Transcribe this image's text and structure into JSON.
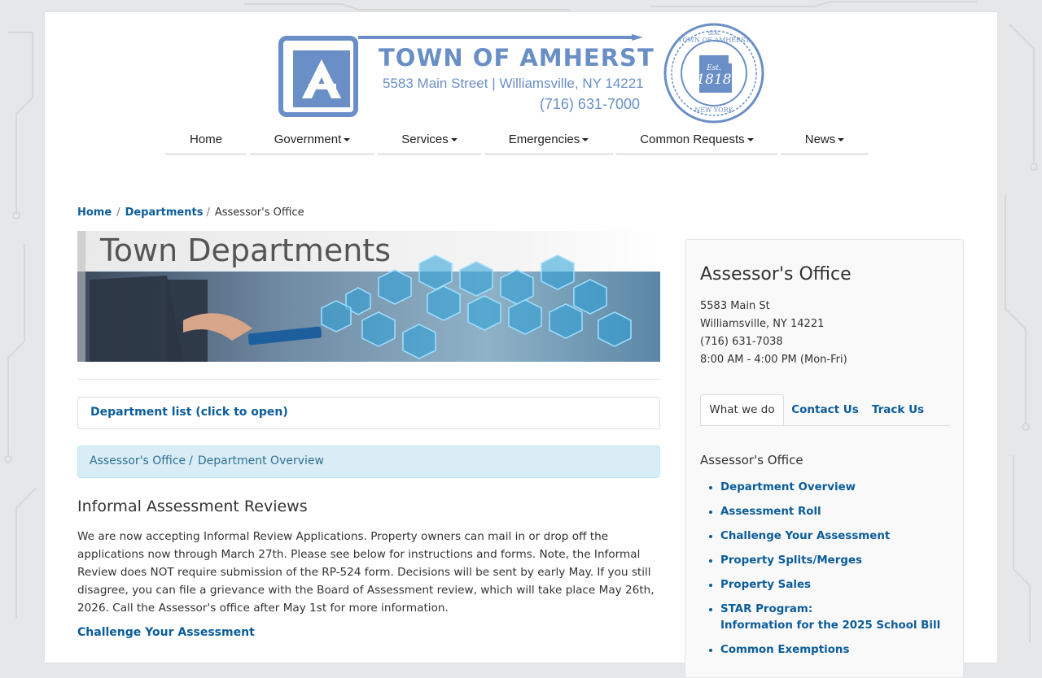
{
  "header": {
    "logo_title": "TOWN OF AMHERST",
    "logo_address": "5583 Main Street  |  Williamsville, NY 14221",
    "logo_phone": "(716) 631-7000",
    "seal_year": "1818",
    "seal_est": "Est.",
    "seal_top": "TOWN OF AMHERST",
    "seal_bottom": "NEW YORK",
    "seal_small": "SEAL"
  },
  "nav": {
    "items": [
      {
        "label": "Home",
        "dropdown": false
      },
      {
        "label": "Government",
        "dropdown": true
      },
      {
        "label": "Services",
        "dropdown": true
      },
      {
        "label": "Emergencies",
        "dropdown": true
      },
      {
        "label": "Common Requests",
        "dropdown": true
      },
      {
        "label": "News",
        "dropdown": true
      }
    ]
  },
  "breadcrumb": {
    "home": "Home",
    "departments": "Departments",
    "current": "Assessor's Office"
  },
  "banner": {
    "title": "Town Departments"
  },
  "department_list_label": "Department list (click to open)",
  "alert": {
    "office": "Assessor's Office",
    "page": "Department Overview"
  },
  "content": {
    "heading": "Informal Assessment Reviews",
    "paragraph": "We are now accepting Informal Review Applications. Property owners can mail in or drop off the applications now through March 27th. Please see below for instructions and forms. Note, the Informal Review does NOT require submission of the RP-524 form. Decisions will be sent by early May. If you still disagree, you can file a grievance with the Board of Assessment review, which will take place May 26th, 2026. Call the Assessor's office after May 1st for more information.",
    "link": "Challenge Your Assessment"
  },
  "sidebar": {
    "title": "Assessor's Office",
    "address1": "5583 Main St",
    "address2": "Williamsville, NY  14221",
    "phone": "(716) 631-7038",
    "hours": "8:00 AM - 4:00 PM (Mon-Fri)",
    "tabs": [
      "What we do",
      "Contact Us",
      "Track Us"
    ],
    "section_heading": "Assessor's Office",
    "links": [
      "Department Overview",
      "Assessment Roll",
      "Challenge Your Assessment",
      "Property Splits/Merges",
      "Property Sales",
      "STAR Program:",
      "Information for the 2025 School Bill",
      "Common Exemptions"
    ]
  },
  "colors": {
    "brand_blue": "#6a8fc7",
    "link_blue": "#0b5d9a",
    "alert_bg": "#d9edf7",
    "alert_text": "#31708f"
  }
}
